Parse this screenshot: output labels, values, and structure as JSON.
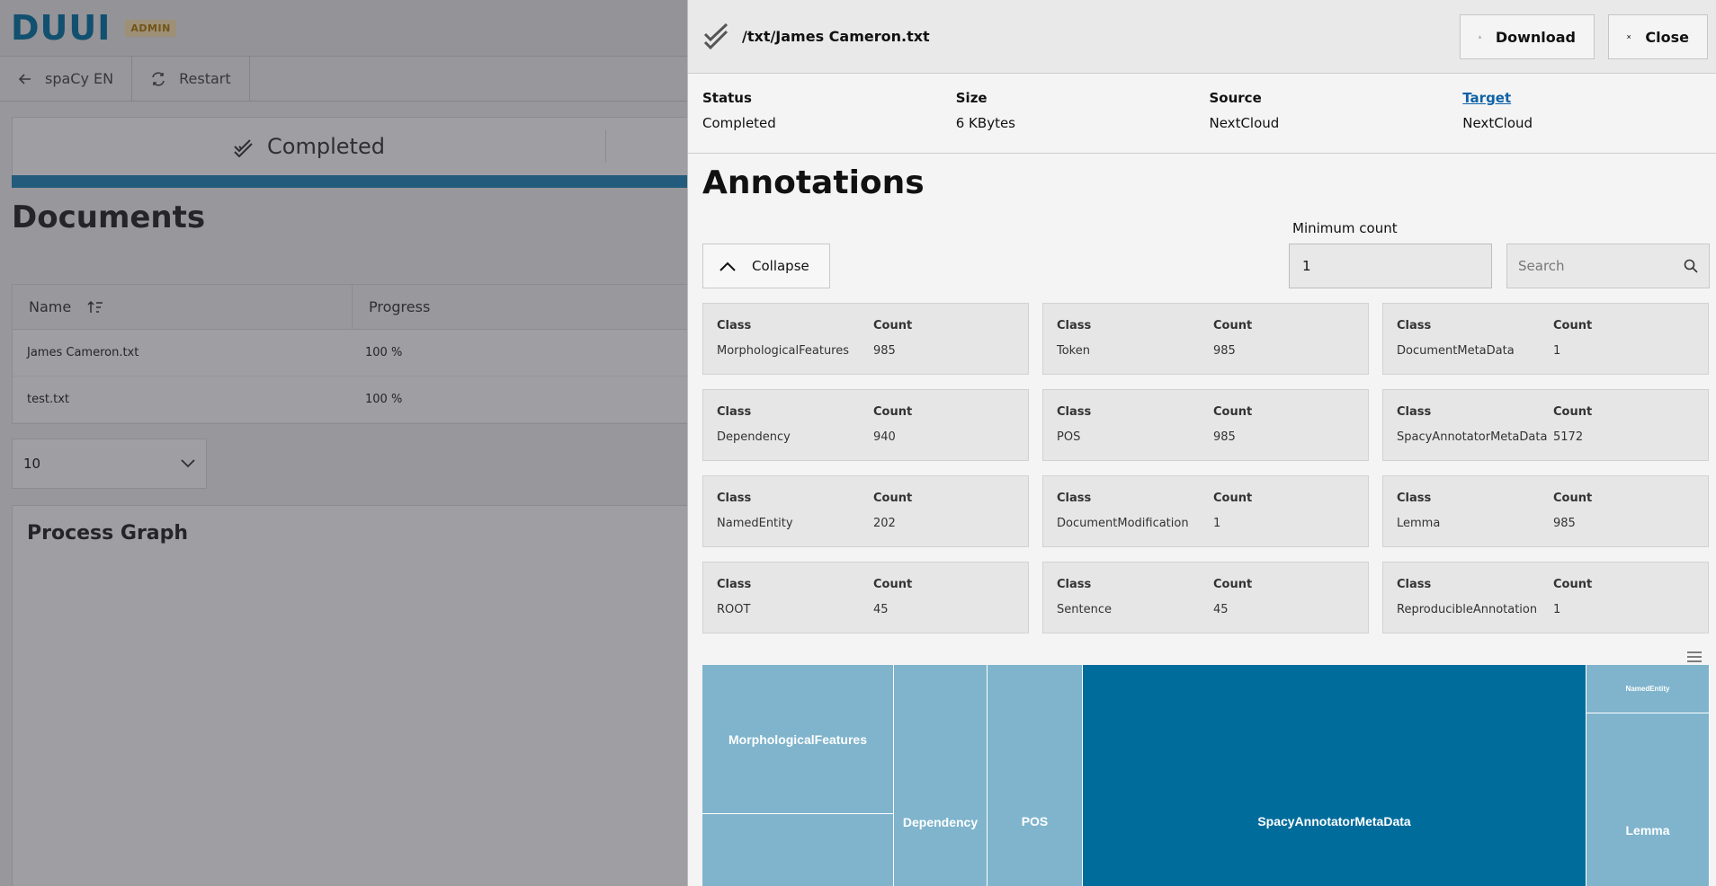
{
  "background": {
    "logo": "DUUI",
    "badge": "ADMIN",
    "back_label": "spaCy EN",
    "restart_label": "Restart",
    "status_label": "Completed",
    "documents_title": "Documents",
    "table": {
      "headers": [
        "Name",
        "Progress"
      ],
      "rows": [
        {
          "name": "James Cameron.txt",
          "progress": "100 %"
        },
        {
          "name": "test.txt",
          "progress": "100 %"
        }
      ]
    },
    "per_page": "10",
    "graph_title": "Process Graph"
  },
  "drawer": {
    "title": "/txt/James Cameron.txt",
    "download_label": "Download",
    "close_label": "Close",
    "meta": [
      {
        "label": "Status",
        "value": "Completed"
      },
      {
        "label": "Size",
        "value": "6 KBytes"
      },
      {
        "label": "Source",
        "value": "NextCloud"
      },
      {
        "label": "Target",
        "value": "NextCloud"
      }
    ],
    "annotations_title": "Annotations",
    "collapse_label": "Collapse",
    "min_count_label": "Minimum count",
    "min_count_value": "1",
    "search_placeholder": "Search",
    "class_label": "Class",
    "count_label": "Count",
    "cards": [
      {
        "class": "MorphologicalFeatures",
        "count": "985"
      },
      {
        "class": "Token",
        "count": "985"
      },
      {
        "class": "DocumentMetaData",
        "count": "1"
      },
      {
        "class": "Dependency",
        "count": "940"
      },
      {
        "class": "POS",
        "count": "985"
      },
      {
        "class": "SpacyAnnotatorMetaData",
        "count": "5172"
      },
      {
        "class": "NamedEntity",
        "count": "202"
      },
      {
        "class": "DocumentModification",
        "count": "1"
      },
      {
        "class": "Lemma",
        "count": "985"
      },
      {
        "class": "ROOT",
        "count": "45"
      },
      {
        "class": "Sentence",
        "count": "45"
      },
      {
        "class": "ReproducibleAnnotation",
        "count": "1"
      }
    ],
    "treemap_labels": {
      "morph": "MorphologicalFeatures",
      "dependency": "Dependency",
      "pos": "POS",
      "spacy": "SpacyAnnotatorMetaData",
      "named": "NamedEntity",
      "lemma": "Lemma"
    },
    "colors": {
      "treemap_light": "#7fb4cc",
      "treemap_dark": "#006c9c",
      "link": "#0f62a8"
    }
  }
}
